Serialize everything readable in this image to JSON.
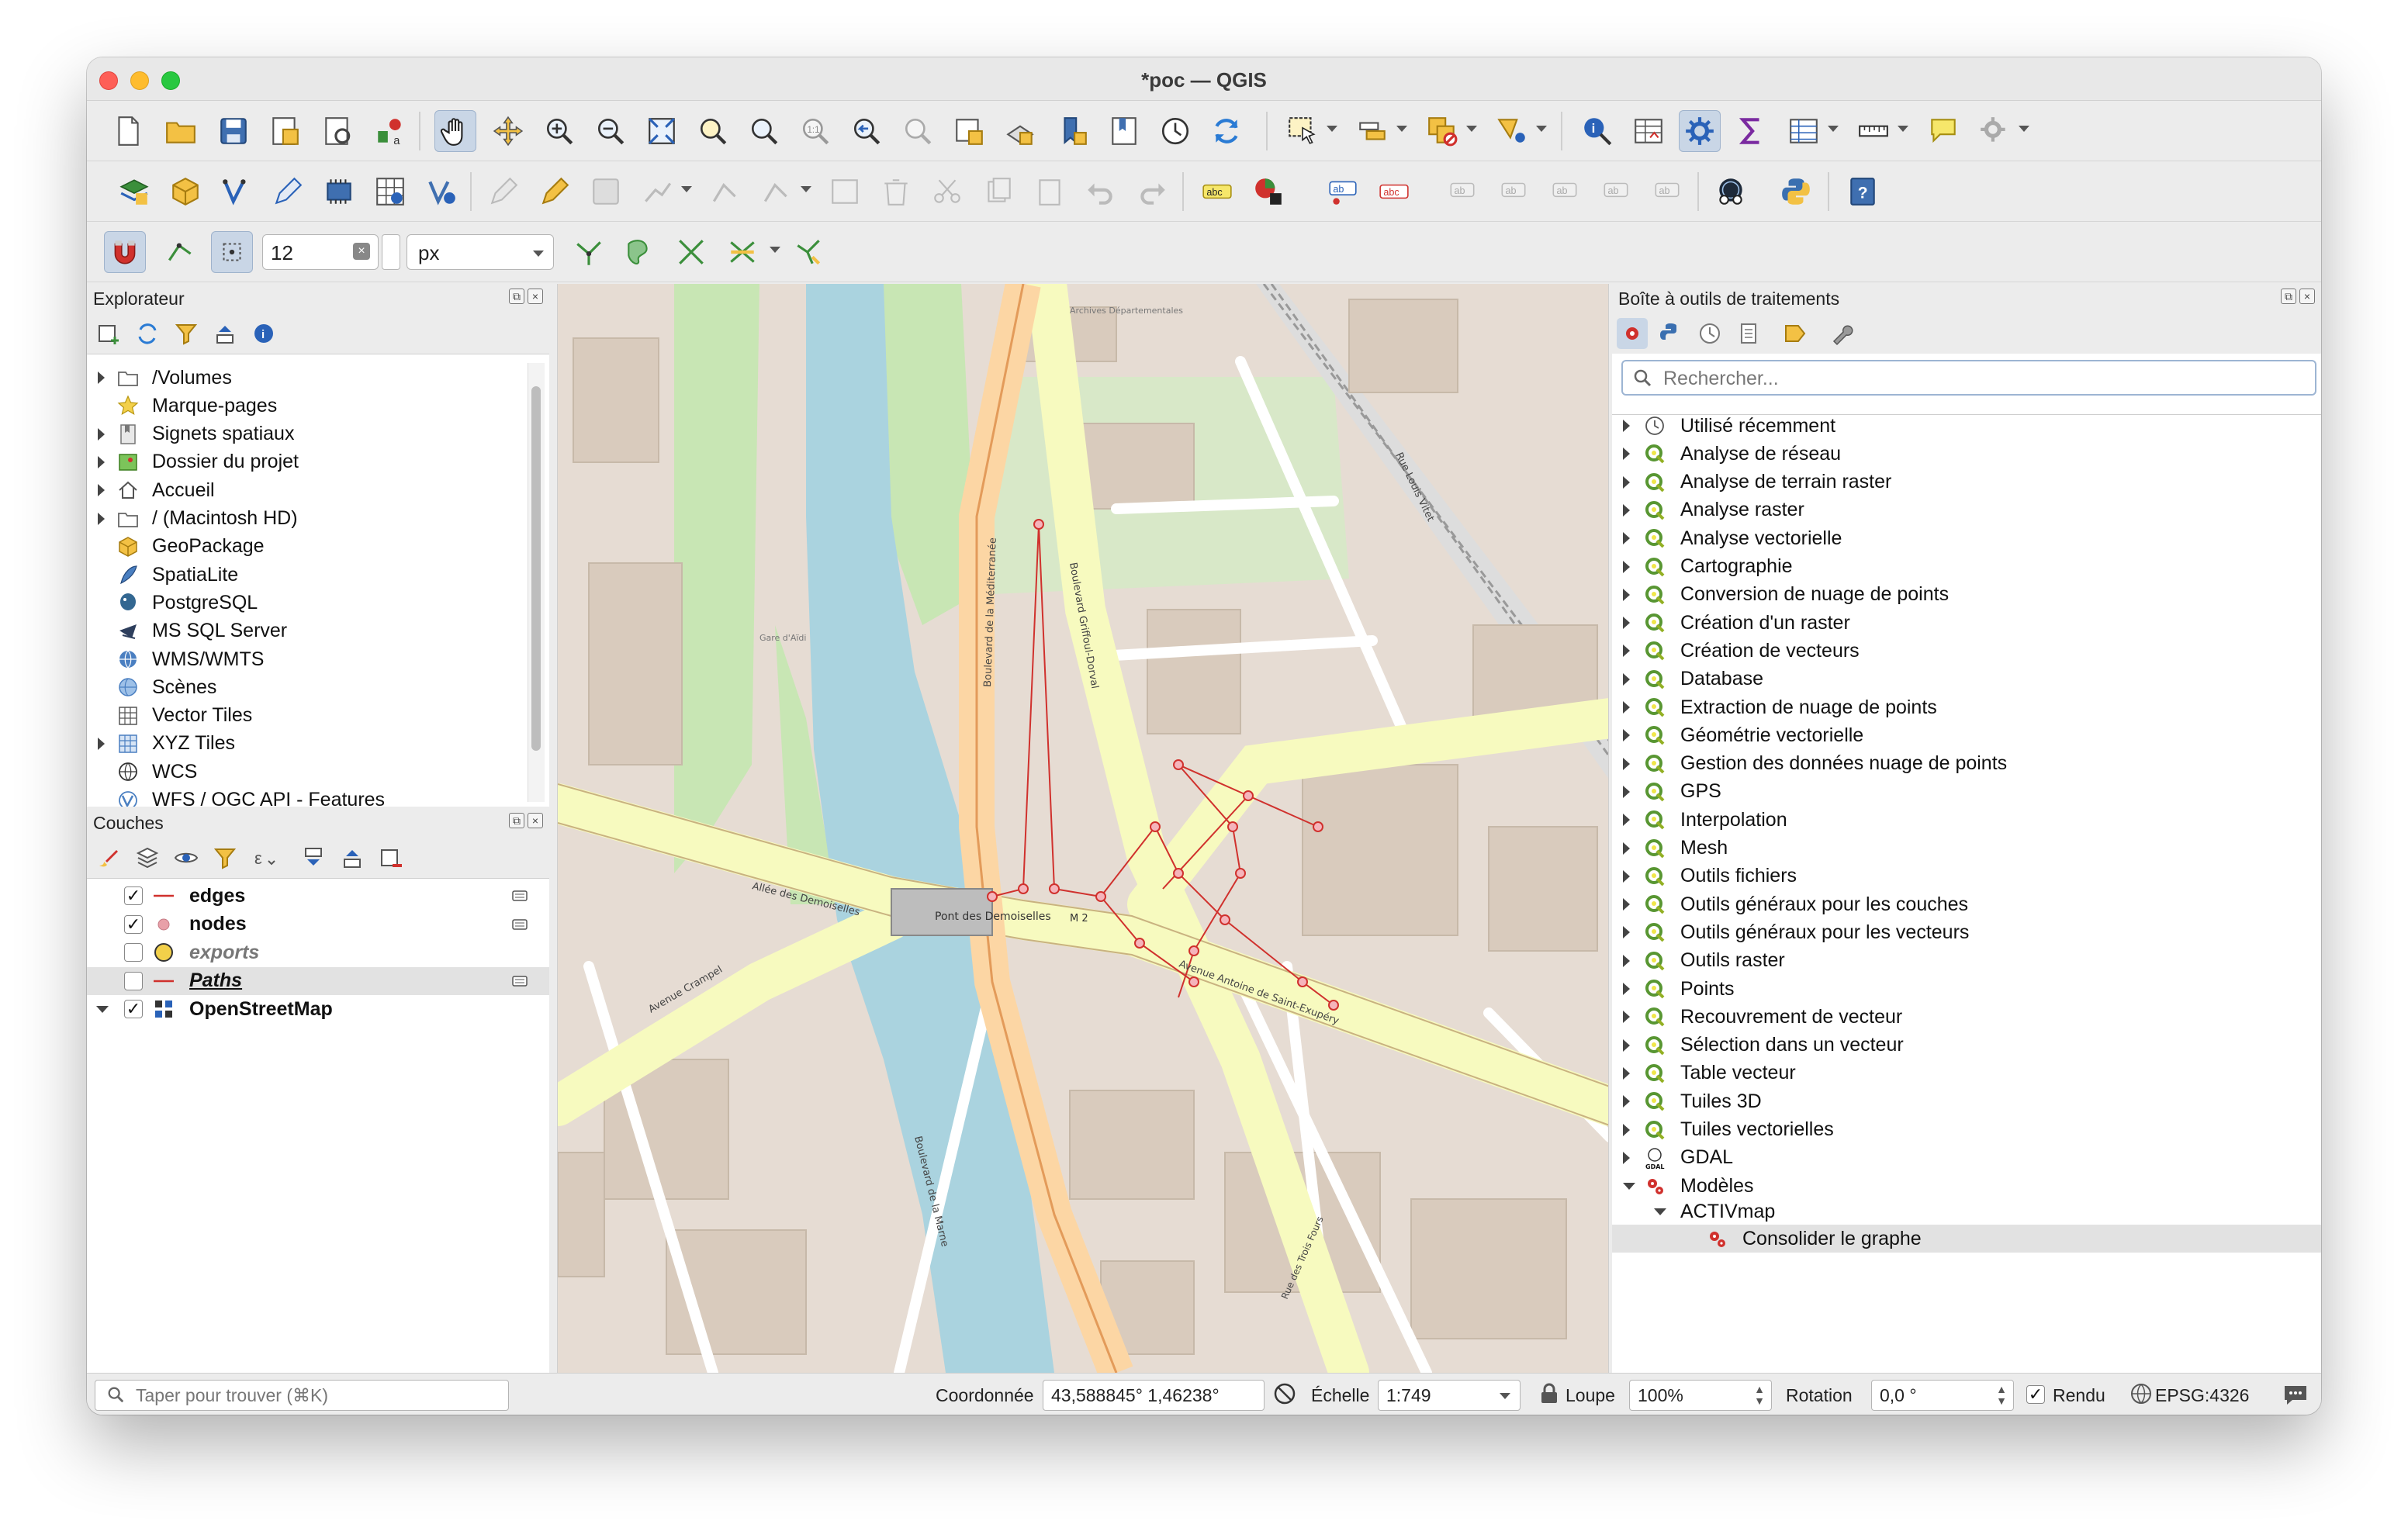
{
  "window": {
    "title": "*poc — QGIS"
  },
  "snapping": {
    "tolerance_value": "12",
    "unit": "px"
  },
  "explorer": {
    "title": "Explorateur",
    "items": [
      {
        "label": "/Volumes",
        "icon": "folder-icon",
        "expandable": true
      },
      {
        "label": "Marque-pages",
        "icon": "star-icon",
        "expandable": false
      },
      {
        "label": "Signets spatiaux",
        "icon": "bookmark-icon",
        "expandable": true
      },
      {
        "label": "Dossier du projet",
        "icon": "project-folder-icon",
        "expandable": true
      },
      {
        "label": "Accueil",
        "icon": "home-icon",
        "expandable": true
      },
      {
        "label": "/ (Macintosh HD)",
        "icon": "folder-icon",
        "expandable": true
      },
      {
        "label": "GeoPackage",
        "icon": "geopackage-icon",
        "expandable": false
      },
      {
        "label": "SpatiaLite",
        "icon": "spatialite-icon",
        "expandable": false
      },
      {
        "label": "PostgreSQL",
        "icon": "postgresql-icon",
        "expandable": false
      },
      {
        "label": "MS SQL Server",
        "icon": "mssql-icon",
        "expandable": false
      },
      {
        "label": "WMS/WMTS",
        "icon": "wms-icon",
        "expandable": false
      },
      {
        "label": "Scènes",
        "icon": "scenes-icon",
        "expandable": false
      },
      {
        "label": "Vector Tiles",
        "icon": "vector-tiles-icon",
        "expandable": false
      },
      {
        "label": "XYZ Tiles",
        "icon": "xyz-tiles-icon",
        "expandable": true
      },
      {
        "label": "WCS",
        "icon": "wcs-icon",
        "expandable": false
      },
      {
        "label": "WFS / OGC API - Features",
        "icon": "wfs-icon",
        "expandable": false
      }
    ]
  },
  "layers": {
    "title": "Couches",
    "items": [
      {
        "label": "edges",
        "checked": true,
        "symbol": "line",
        "color": "#d0312d",
        "style": "bold"
      },
      {
        "label": "nodes",
        "checked": true,
        "symbol": "point",
        "color": "#e8a0a8",
        "style": "bold"
      },
      {
        "label": "exports",
        "checked": false,
        "symbol": "polygon",
        "color": "#f2d04a",
        "style": "italic"
      },
      {
        "label": "Paths",
        "checked": false,
        "symbol": "line",
        "color": "#d0312d",
        "style": "bold-italic-underline"
      },
      {
        "label": "OpenStreetMap",
        "checked": true,
        "symbol": "raster",
        "color": "#333333",
        "style": "bold"
      }
    ]
  },
  "processing": {
    "title": "Boîte à outils de traitements",
    "search_placeholder": "Rechercher...",
    "items": [
      {
        "label": "Utilisé récemment",
        "icon": "clock-icon"
      },
      {
        "label": "Analyse de réseau",
        "icon": "qgis-q-icon"
      },
      {
        "label": "Analyse de terrain raster",
        "icon": "qgis-q-icon"
      },
      {
        "label": "Analyse raster",
        "icon": "qgis-q-icon"
      },
      {
        "label": "Analyse vectorielle",
        "icon": "qgis-q-icon"
      },
      {
        "label": "Cartographie",
        "icon": "qgis-q-icon"
      },
      {
        "label": "Conversion de nuage de points",
        "icon": "qgis-q-icon"
      },
      {
        "label": "Création d'un raster",
        "icon": "qgis-q-icon"
      },
      {
        "label": "Création de vecteurs",
        "icon": "qgis-q-icon"
      },
      {
        "label": "Database",
        "icon": "qgis-q-icon"
      },
      {
        "label": "Extraction de nuage de points",
        "icon": "qgis-q-icon"
      },
      {
        "label": "Géométrie vectorielle",
        "icon": "qgis-q-icon"
      },
      {
        "label": "Gestion des données nuage de points",
        "icon": "qgis-q-icon"
      },
      {
        "label": "GPS",
        "icon": "qgis-q-icon"
      },
      {
        "label": "Interpolation",
        "icon": "qgis-q-icon"
      },
      {
        "label": "Mesh",
        "icon": "qgis-q-icon"
      },
      {
        "label": "Outils fichiers",
        "icon": "qgis-q-icon"
      },
      {
        "label": "Outils généraux pour les couches",
        "icon": "qgis-q-icon"
      },
      {
        "label": "Outils généraux pour les vecteurs",
        "icon": "qgis-q-icon"
      },
      {
        "label": "Outils raster",
        "icon": "qgis-q-icon"
      },
      {
        "label": "Points",
        "icon": "qgis-q-icon"
      },
      {
        "label": "Recouvrement de vecteur",
        "icon": "qgis-q-icon"
      },
      {
        "label": "Sélection dans un vecteur",
        "icon": "qgis-q-icon"
      },
      {
        "label": "Table vecteur",
        "icon": "qgis-q-icon"
      },
      {
        "label": "Tuiles 3D",
        "icon": "qgis-q-icon"
      },
      {
        "label": "Tuiles vectorielles",
        "icon": "qgis-q-icon"
      },
      {
        "label": "GDAL",
        "icon": "gdal-icon"
      },
      {
        "label": "Modèles",
        "icon": "models-gear-icon"
      }
    ],
    "models_group": "ACTIVmap",
    "model_item": "Consolider le graphe"
  },
  "map_labels": {
    "quay": "Allée des Demoiselles",
    "boulevard_mediterranee": "Boulevard de la Méditerranée",
    "boulevard_griffoul": "Boulevard Griffoul-Dorval",
    "pont": "Pont des Demoiselles",
    "avenue_st_exupery": "Avenue Antoine de Saint-Exupéry",
    "rue_louis_vitet": "Rue Louis Vitet",
    "boulevard_marne": "Boulevard de la Marne",
    "avenue_crampel": "Avenue Crampel",
    "route_m2": "M 2",
    "archives": "Archives Départementales",
    "gare": "Gare d'Aïdi",
    "rue_trois_fours": "Rue des Trois Fours"
  },
  "statusbar": {
    "locate_placeholder": "Taper pour trouver (⌘K)",
    "coord_label": "Coordonnée",
    "coord_value": "43,588845°  1,46238°",
    "scale_label": "Échelle",
    "scale_value": "1:749",
    "magnifier_label": "Loupe",
    "magnifier_value": "100%",
    "rotation_label": "Rotation",
    "rotation_value": "0,0 °",
    "render_label": "Rendu",
    "crs_label": "EPSG:4326"
  }
}
